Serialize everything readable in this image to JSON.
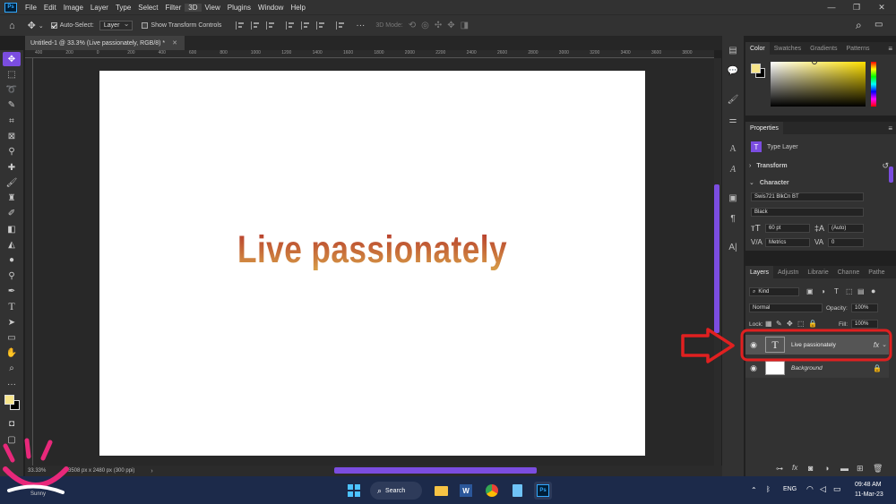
{
  "menu": {
    "items": [
      "File",
      "Edit",
      "Image",
      "Layer",
      "Type",
      "Select",
      "Filter",
      "3D",
      "View",
      "Plugins",
      "Window",
      "Help"
    ]
  },
  "options_bar": {
    "auto_select_label": "Auto-Select:",
    "auto_select_value": "Layer",
    "transform_controls_label": "Show Transform Controls",
    "mode_3d_label": "3D Mode:"
  },
  "document": {
    "tab_title": "Untitled-1 @ 33.3% (Live passionately, RGB/8) *",
    "canvas_text": "Live passionately",
    "zoom": "33.33%",
    "doc_info": "3508 px x 2480 px (300 ppi)",
    "ruler_marks": [
      "400",
      "200",
      "0",
      "200",
      "400",
      "600",
      "800",
      "1000",
      "1200",
      "1400",
      "1600",
      "1800",
      "2000",
      "2200",
      "2400",
      "2600",
      "2800",
      "3000",
      "3200",
      "3400",
      "3600",
      "3800"
    ]
  },
  "color_panel": {
    "tabs": [
      "Color",
      "Swatches",
      "Gradients",
      "Patterns"
    ],
    "foreground": "#f7e58a",
    "background": "#000000"
  },
  "properties_panel": {
    "title": "Properties",
    "layer_type": "Type Layer",
    "transform_label": "Transform",
    "character_label": "Character",
    "font_family": "Swis721 BlkCn BT",
    "font_style": "Black",
    "font_size": "60 pt",
    "leading": "(Auto)",
    "kerning": "Metrics",
    "tracking": "0"
  },
  "layers_panel": {
    "tabs": [
      "Layers",
      "Adjustn",
      "Librarie",
      "Channe",
      "Pathe"
    ],
    "filter_kind": "Kind",
    "blend_mode": "Normal",
    "opacity_label": "Opacity:",
    "opacity_value": "100%",
    "lock_label": "Lock:",
    "fill_label": "Fill:",
    "fill_value": "100%",
    "layers": [
      {
        "name": "Live passionately",
        "type": "text",
        "fx": "fx",
        "selected": true
      },
      {
        "name": "Background",
        "type": "background",
        "locked": true
      }
    ]
  },
  "taskbar": {
    "weather_temp": "54°F",
    "weather_desc": "Sunny",
    "search_label": "Search",
    "language": "ENG",
    "time": "09:48 AM",
    "date": "11-Mar-23"
  },
  "colors": {
    "accent": "#7b4de0",
    "highlight_box": "#e02020",
    "text_gradient_top": "#b4332a",
    "text_gradient_bottom": "#d9a24a"
  }
}
